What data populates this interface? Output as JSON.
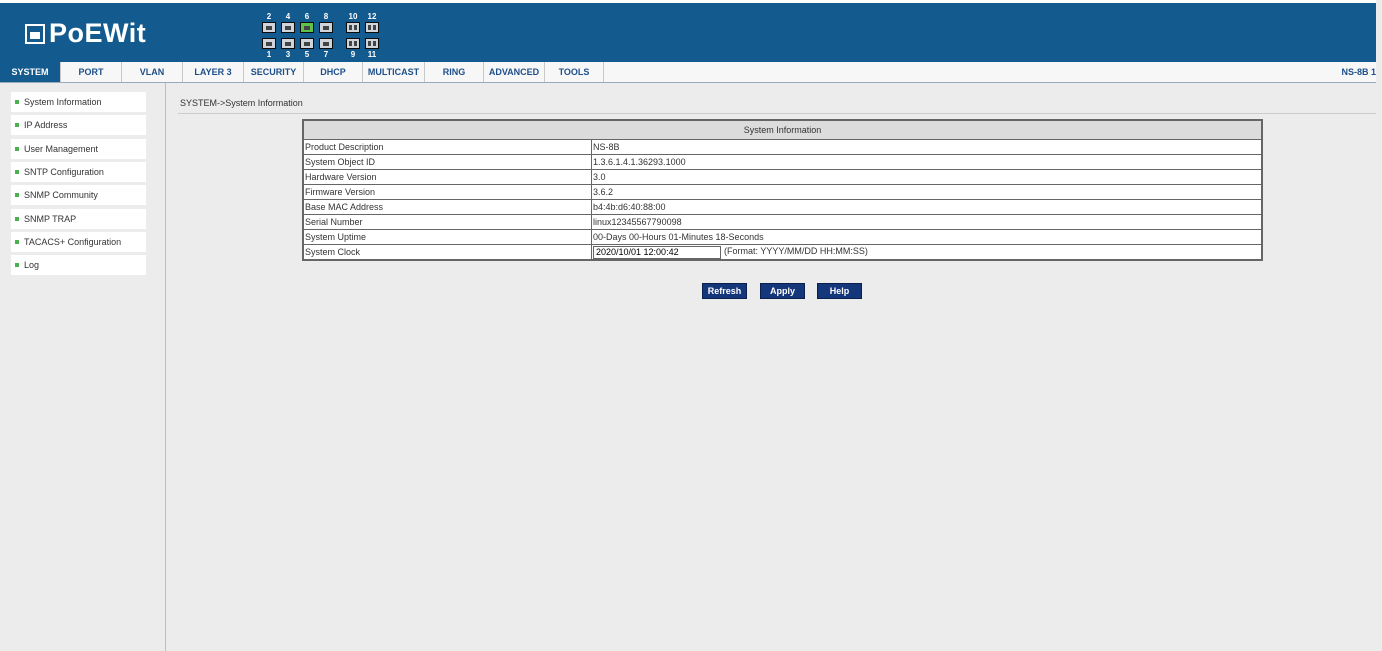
{
  "header": {
    "logo_text": "PoEWit",
    "ports": [
      {
        "label": "1",
        "active": false
      },
      {
        "label": "2",
        "active": false
      },
      {
        "label": "3",
        "active": false
      },
      {
        "label": "4",
        "active": false
      },
      {
        "label": "5",
        "active": false
      },
      {
        "label": "6",
        "active": true
      },
      {
        "label": "7",
        "active": false
      },
      {
        "label": "8",
        "active": false
      },
      {
        "label": "9",
        "active": false
      },
      {
        "label": "10",
        "active": false
      },
      {
        "label": "11",
        "active": false
      },
      {
        "label": "12",
        "active": false
      }
    ]
  },
  "nav": {
    "items": [
      "SYSTEM",
      "PORT",
      "VLAN",
      "LAYER 3",
      "SECURITY",
      "DHCP",
      "MULTICAST",
      "RING",
      "ADVANCED",
      "TOOLS"
    ],
    "active": "SYSTEM",
    "model": "NS-8B 1"
  },
  "sidebar": {
    "items": [
      "System Information",
      "IP Address",
      "User Management",
      "SNTP Configuration",
      "SNMP Community",
      "SNMP TRAP",
      "TACACS+ Configuration",
      "Log"
    ]
  },
  "breadcrumb": "SYSTEM->System Information",
  "info_table": {
    "title": "System Information",
    "rows": [
      {
        "label": "Product Description",
        "value": "NS-8B"
      },
      {
        "label": "System Object ID",
        "value": "1.3.6.1.4.1.36293.1000"
      },
      {
        "label": "Hardware Version",
        "value": "3.0"
      },
      {
        "label": "Firmware Version",
        "value": "3.6.2"
      },
      {
        "label": "Base MAC Address",
        "value": "b4:4b:d6:40:88:00"
      },
      {
        "label": "Serial Number",
        "value": "linux12345567790098"
      },
      {
        "label": "System Uptime",
        "value": "00-Days 00-Hours 01-Minutes 18-Seconds"
      }
    ],
    "clock_label": "System Clock",
    "clock_value": "2020/10/01 12:00:42",
    "clock_format": "(Format: YYYY/MM/DD HH:MM:SS)"
  },
  "buttons": {
    "refresh": "Refresh",
    "apply": "Apply",
    "help": "Help"
  },
  "colors": {
    "header_bg": "#135a8f",
    "button_bg": "#14367a",
    "port_active": "#5fc24a"
  }
}
